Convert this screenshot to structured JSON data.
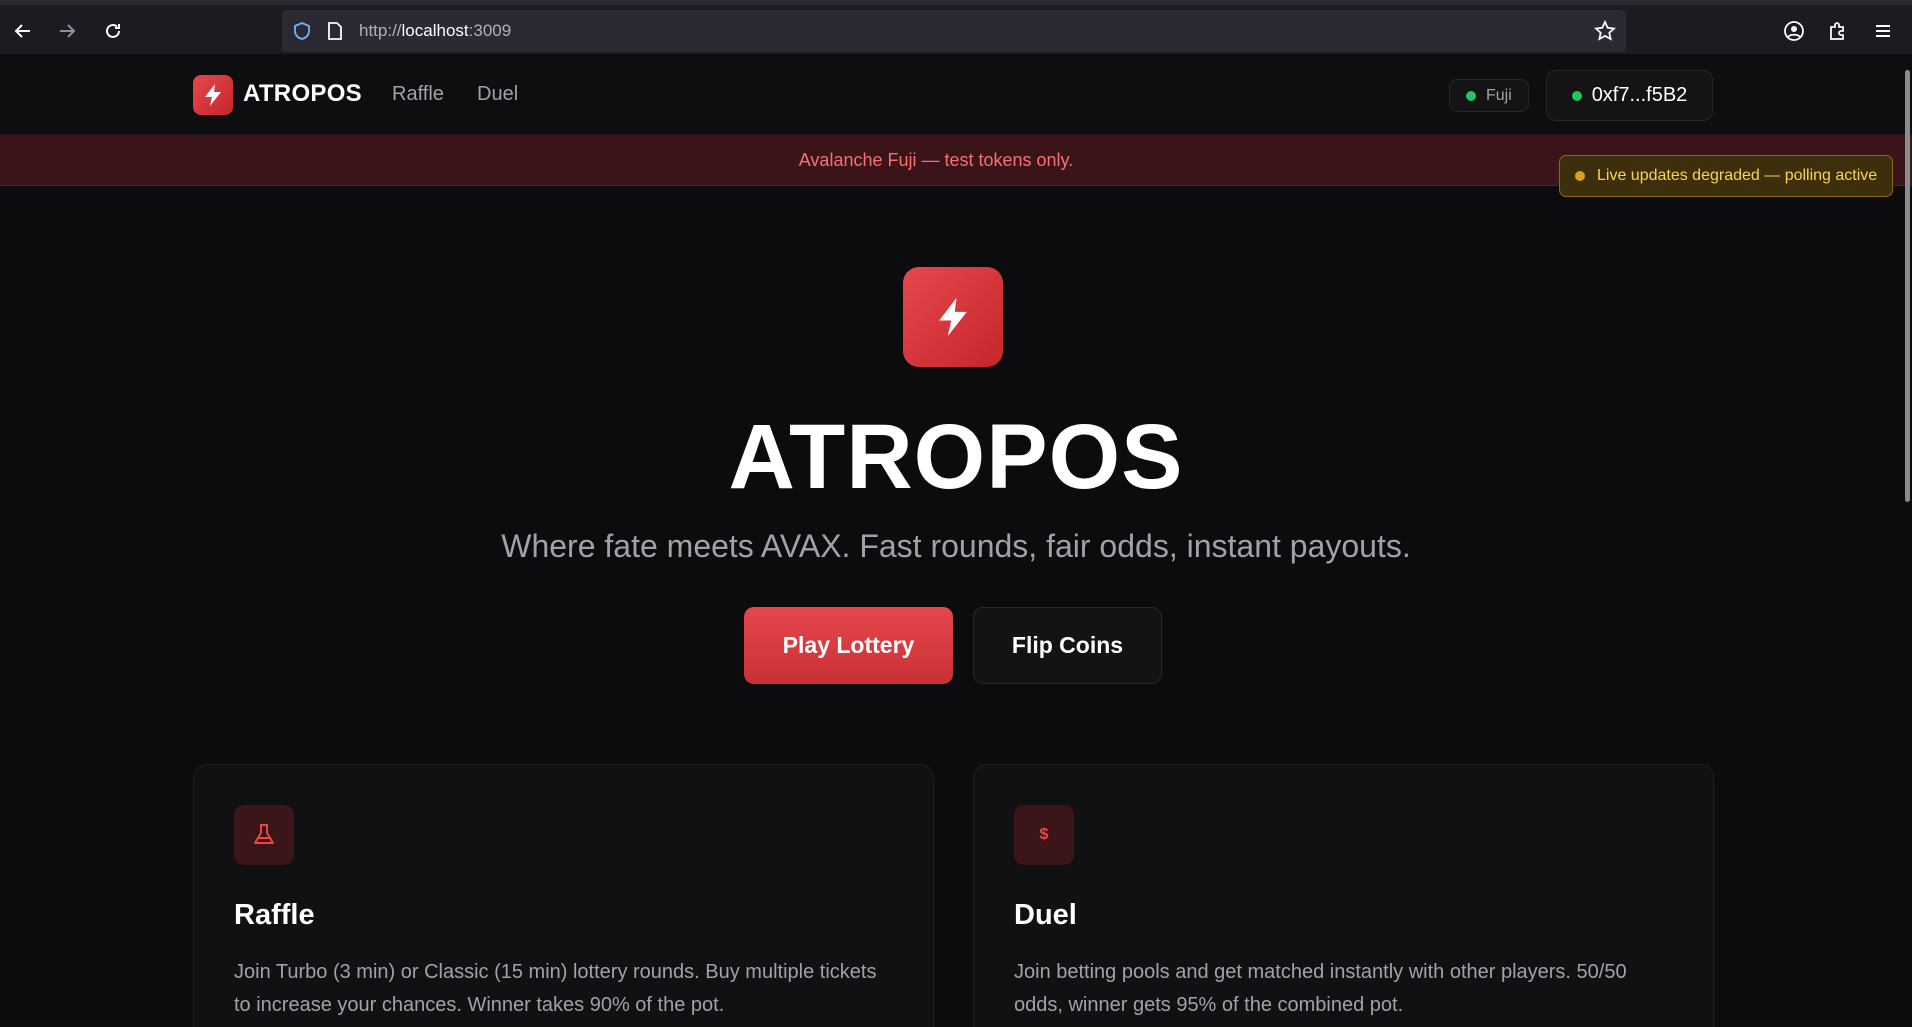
{
  "browser": {
    "url_prefix": "http://",
    "url_host": "localhost",
    "url_port": ":3009"
  },
  "header": {
    "brand": "ATROPOS",
    "nav": [
      "Raffle",
      "Duel"
    ],
    "network": "Fuji",
    "wallet": "0xf7...f5B2"
  },
  "banner": {
    "text": "Avalanche Fuji — test tokens only.",
    "status": "Live updates degraded — polling active"
  },
  "hero": {
    "title": "ATROPOS",
    "subtitle": "Where fate meets AVAX. Fast rounds, fair odds, instant payouts.",
    "primary_cta": "Play Lottery",
    "secondary_cta": "Flip Coins"
  },
  "cards": [
    {
      "icon": "flask-icon",
      "title": "Raffle",
      "description": "Join Turbo (3 min) or Classic (15 min) lottery rounds. Buy multiple tickets to increase your chances. Winner takes 90% of the pot."
    },
    {
      "icon": "dollar-icon",
      "icon_text": "$",
      "title": "Duel",
      "description": "Join betting pools and get matched instantly with other players. 50/50 odds, winner gets 95% of the combined pot."
    }
  ],
  "colors": {
    "accent": "#e5484d",
    "background": "#0c0c0e",
    "online": "#22c55e",
    "warning": "#fcd34d"
  }
}
